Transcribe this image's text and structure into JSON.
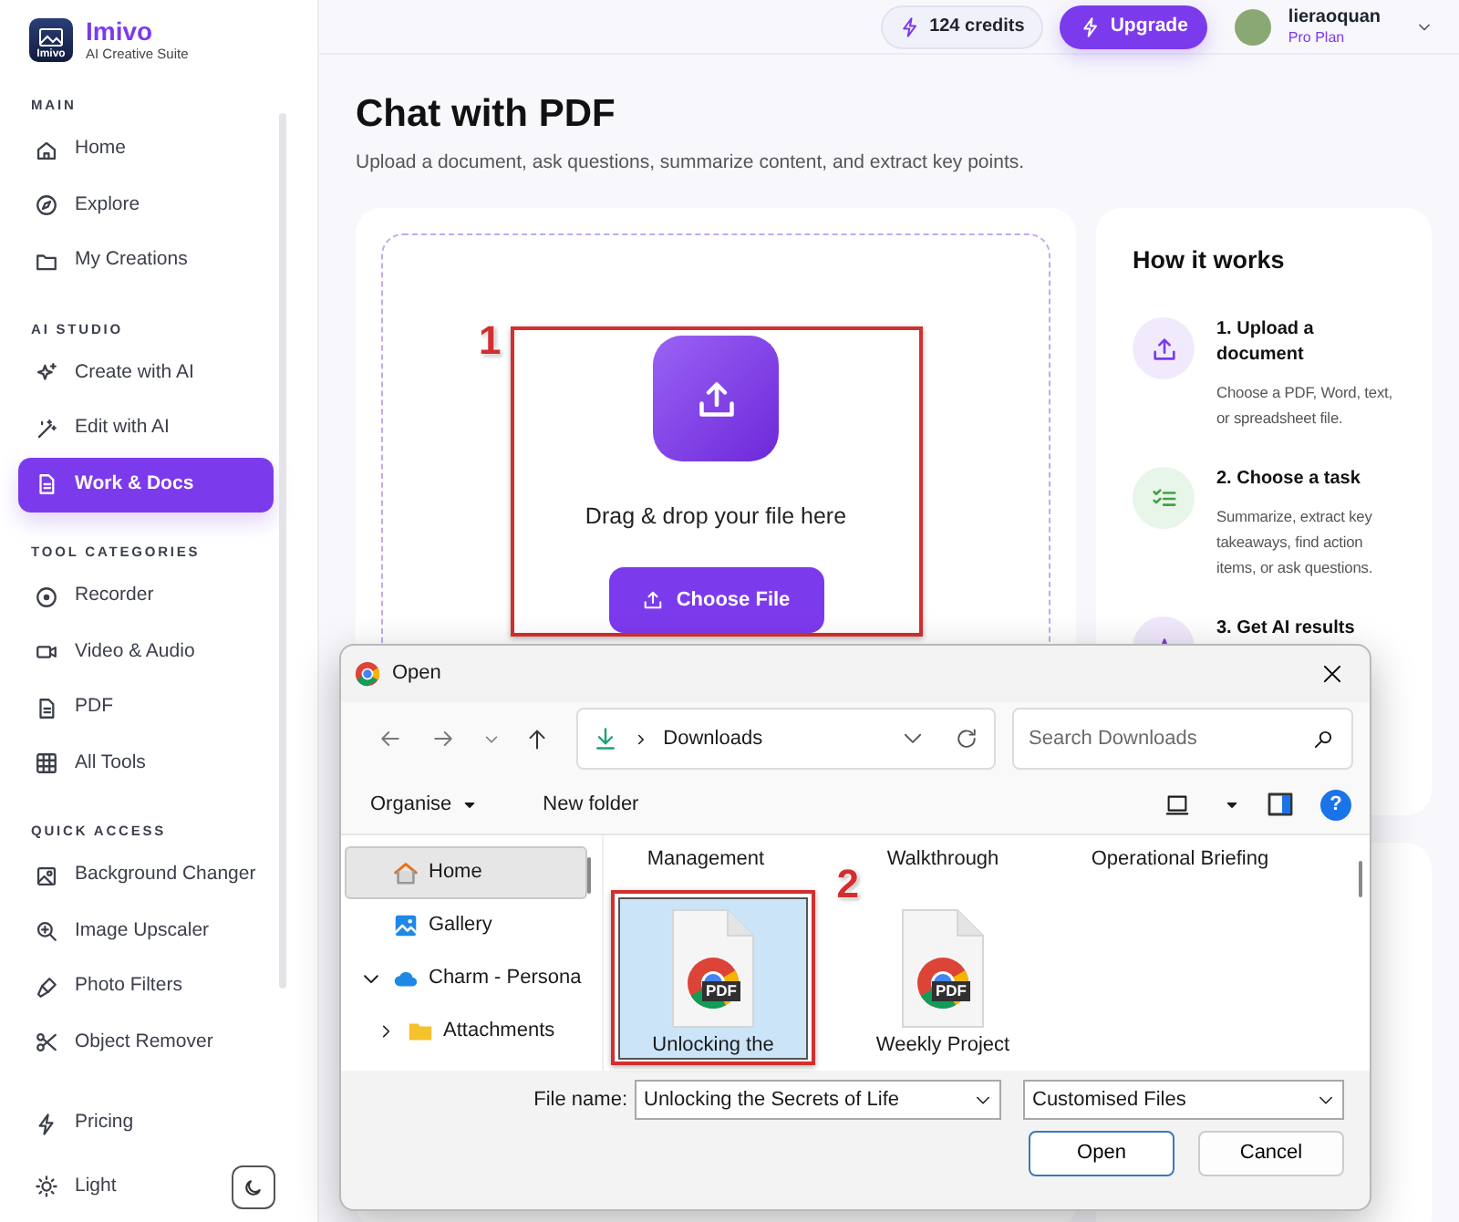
{
  "sidebar": {
    "logo_text": "Imivo",
    "brand": "Imivo",
    "tagline": "AI Creative Suite",
    "sections": [
      {
        "heading": "MAIN",
        "items": [
          {
            "label": "Home",
            "selected": false
          },
          {
            "label": "Explore",
            "selected": false
          },
          {
            "label": "My Creations",
            "selected": false
          }
        ]
      },
      {
        "heading": "AI STUDIO",
        "items": [
          {
            "label": "Create with AI",
            "selected": false
          },
          {
            "label": "Edit with AI",
            "selected": false
          },
          {
            "label": "Work & Docs",
            "selected": true
          }
        ]
      },
      {
        "heading": "TOOL CATEGORIES",
        "items": [
          {
            "label": "Recorder",
            "selected": false
          },
          {
            "label": "Video & Audio",
            "selected": false
          },
          {
            "label": "PDF",
            "selected": false
          },
          {
            "label": "All Tools",
            "selected": false
          }
        ]
      },
      {
        "heading": "QUICK ACCESS",
        "items": [
          {
            "label": "Background Changer",
            "selected": false
          },
          {
            "label": "Image Upscaler",
            "selected": false
          },
          {
            "label": "Photo Filters",
            "selected": false
          },
          {
            "label": "Object Remover",
            "selected": false
          }
        ]
      }
    ],
    "pricing": "Pricing",
    "theme": "Light"
  },
  "header": {
    "credits": "124 credits",
    "upgrade": "Upgrade",
    "user": "lieraoquan",
    "plan": "Pro Plan"
  },
  "page": {
    "title": "Chat with PDF",
    "subtitle": "Upload a document, ask questions, summarize content, and extract key points.",
    "upload": {
      "prompt": "Drag & drop your file here",
      "button": "Choose File",
      "annotation": "1"
    }
  },
  "how_it_works": {
    "title": "How it works",
    "steps": [
      {
        "title": "1. Upload a document",
        "description": "Choose a PDF, Word, text, or spreadsheet file."
      },
      {
        "title": "2. Choose a task",
        "description": "Summarize, extract key takeaways, find action items, or ask questions."
      },
      {
        "title": "3. Get AI results"
      }
    ]
  },
  "dialog": {
    "title": "Open",
    "path": "Downloads",
    "search_placeholder": "Search Downloads",
    "toolbar": [
      "Organise",
      "New folder"
    ],
    "help": "?",
    "nav_tree": [
      {
        "label": "Home",
        "selected": true
      },
      {
        "label": "Gallery",
        "selected": false
      },
      {
        "label": "Charm - Persona",
        "selected": false,
        "expanded": true,
        "children": [
          {
            "label": "Attachments",
            "selected": false,
            "expanded": false
          }
        ]
      }
    ],
    "files": [
      {
        "name": "Management",
        "selected": false
      },
      {
        "name": "Walkthrough",
        "selected": false
      },
      {
        "name": "Operational Briefing",
        "selected": false
      },
      {
        "name": "Unlocking the",
        "selected": true,
        "badge": "PDF",
        "annotation": "2"
      },
      {
        "name": "Weekly Project",
        "selected": false,
        "badge": "PDF"
      }
    ],
    "file_name_label": "File name:",
    "file_name": "Unlocking the Secrets of Life",
    "file_type": "Customised Files",
    "buttons": [
      "Open",
      "Cancel"
    ]
  }
}
